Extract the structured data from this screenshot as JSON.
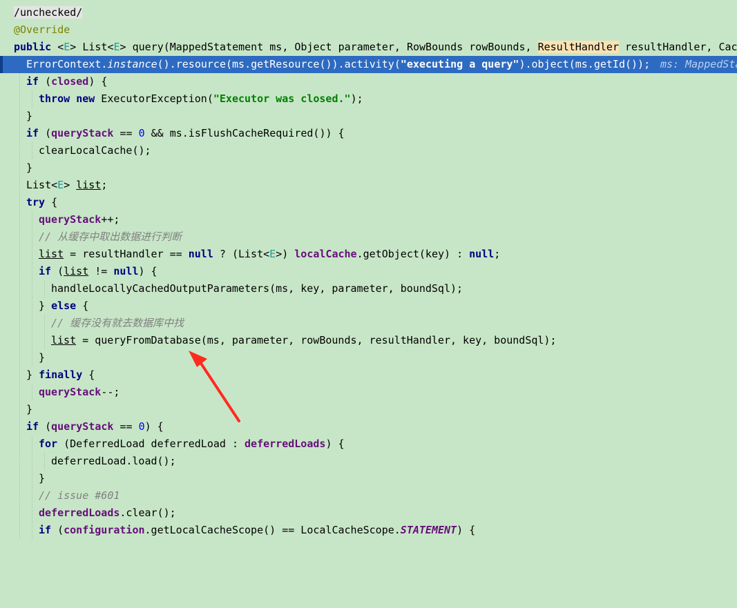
{
  "editor": {
    "lines": {
      "l0": {
        "a": "/unchecked/"
      },
      "l1": {
        "a": "@Override"
      },
      "l2": {
        "a": "public",
        "b": " <",
        "c": "E",
        "d": "> List<",
        "e": "E",
        "f": "> query(MappedStatement ms, Object parameter, RowBounds rowBounds, ",
        "g": "ResultHandler",
        "h": " resultHandler, Cach"
      },
      "l3": {
        "a": "ErrorContext.",
        "b": "instance",
        "c": "().resource(ms.getResource()).activity(",
        "d": "\"executing a query\"",
        "e": ").object(ms.getId());",
        "f": "ms: MappedSta"
      },
      "l4": {
        "a": "if",
        "b": " (",
        "c": "closed",
        "d": ") {"
      },
      "l5": {
        "a": "throw",
        "b": " ",
        "c": "new",
        "d": " ExecutorException(",
        "e": "\"Executor was closed.\"",
        "f": ");"
      },
      "l6": {
        "a": "}"
      },
      "l7": {
        "a": "if",
        "b": " (",
        "c": "queryStack",
        "d": " == ",
        "e": "0",
        "f": " && ms.isFlushCacheRequired()) {"
      },
      "l8": {
        "a": "clearLocalCache();"
      },
      "l9": {
        "a": "}"
      },
      "l10": {
        "a": "List<",
        "b": "E",
        "c": "> ",
        "d": "list",
        "e": ";"
      },
      "l11": {
        "a": "try",
        "b": " {"
      },
      "l12": {
        "a": "queryStack",
        "b": "++;"
      },
      "l13": {
        "a": "// 从缓存中取出数据进行判断"
      },
      "l14": {
        "a": "list",
        "b": " = resultHandler == ",
        "c": "null",
        "d": " ? (List<",
        "e": "E",
        "f": ">) ",
        "g": "localCache",
        "h": ".getObject(key) : ",
        "i": "null",
        "j": ";"
      },
      "l15": {
        "a": "if",
        "b": " (",
        "c": "list",
        "d": " != ",
        "e": "null",
        "f": ") {"
      },
      "l16": {
        "a": "handleLocallyCachedOutputParameters(ms, key, parameter, boundSql);"
      },
      "l17": {
        "a": "} ",
        "b": "else",
        "c": " {"
      },
      "l18": {
        "a": "// 缓存没有就去数据库中找"
      },
      "l19": {
        "a": "list",
        "b": " = queryFromDatabase(ms, parameter, rowBounds, resultHandler, key, boundSql);"
      },
      "l20": {
        "a": "}"
      },
      "l21": {
        "a": "} ",
        "b": "finally",
        "c": " {"
      },
      "l22": {
        "a": "queryStack",
        "b": "--;"
      },
      "l23": {
        "a": "}"
      },
      "l24": {
        "a": "if",
        "b": " (",
        "c": "queryStack",
        "d": " == ",
        "e": "0",
        "f": ") {"
      },
      "l25": {
        "a": "for",
        "b": " (DeferredLoad deferredLoad : ",
        "c": "deferredLoads",
        "d": ") {"
      },
      "l26": {
        "a": "deferredLoad.load();"
      },
      "l27": {
        "a": "}"
      },
      "l28": {
        "a": "// issue #601"
      },
      "l29": {
        "a": "deferredLoads",
        "b": ".clear();"
      },
      "l30": {
        "a": "if",
        "b": " (",
        "c": "configuration",
        "d": ".getLocalCacheScope() == LocalCacheScope.",
        "e": "STATEMENT",
        "f": ") {"
      }
    }
  },
  "colors": {
    "background": "#c7e6c7",
    "selection": "#2d6bc2",
    "keyword": "#000080",
    "field": "#660e7a",
    "string": "#008000",
    "comment": "#808080",
    "arrow": "#ff2b1f"
  }
}
